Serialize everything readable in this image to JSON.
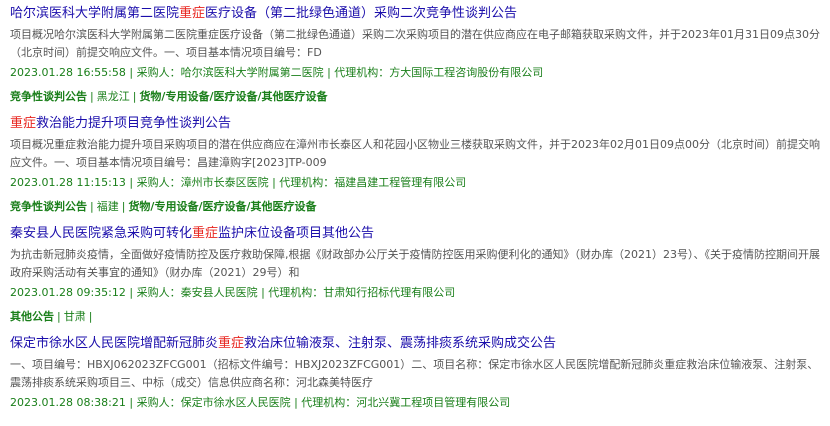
{
  "results": [
    {
      "title_pre": "哈尔滨医科大学附属第二医院",
      "title_kw": "重症",
      "title_post": "医疗设备（第二批绿色通道）采购二次竞争性谈判公告",
      "summary": "项目概况哈尔滨医科大学附属第二医院重症医疗设备（第二批绿色通道）采购二次采购项目的潜在供应商应在电子邮箱获取采购文件，并于2023年01月31日09点30分（北京时间）前提交响应文件。一、项目基本情况项目编号：FD",
      "date": "2023.01.28 16:55:58",
      "buyer_label": "采购人：",
      "buyer": "哈尔滨医科大学附属第二医院",
      "agency_label": "代理机构：",
      "agency": "方大国际工程咨询股份有限公司",
      "tag_type": "竞争性谈判公告",
      "tag_region": "黑龙江",
      "tag_category": "货物/专用设备/医疗设备/其他医疗设备"
    },
    {
      "title_pre": "",
      "title_kw": "重症",
      "title_post": "救治能力提升项目竞争性谈判公告",
      "summary": "项目概况重症救治能力提升项目采购项目的潜在供应商应在漳州市长泰区人和花园小区物业三楼获取采购文件，并于2023年02月01日09点00分（北京时间）前提交响应文件。一、项目基本情况项目编号：昌建漳购字[2023]TP-009",
      "date": "2023.01.28 11:15:13",
      "buyer_label": "采购人：",
      "buyer": "漳州市长泰区医院",
      "agency_label": "代理机构：",
      "agency": "福建昌建工程管理有限公司",
      "tag_type": "竞争性谈判公告",
      "tag_region": "福建",
      "tag_category": "货物/专用设备/医疗设备/其他医疗设备"
    },
    {
      "title_pre": "秦安县人民医院紧急采购可转化",
      "title_kw": "重症",
      "title_post": "监护床位设备项目其他公告",
      "summary": "为抗击新冠肺炎疫情，全面做好疫情防控及医疗救助保障,根据《财政部办公厅关于疫情防控医用采购便利化的通知》（财办库（2021）23号）、《关于疫情防控期间开展政府采购活动有关事宜的通知》（财办库（2021）29号）和",
      "date": "2023.01.28 09:35:12",
      "buyer_label": "采购人：",
      "buyer": "秦安县人民医院",
      "agency_label": "代理机构：",
      "agency": "甘肃知行招标代理有限公司",
      "tag_type": "其他公告",
      "tag_region": "甘肃",
      "tag_category": ""
    },
    {
      "title_pre": "保定市徐水区人民医院增配新冠肺炎",
      "title_kw": "重症",
      "title_post": "救治床位输液泵、注射泵、震荡排痰系统采购成交公告",
      "summary": "一、项目编号：HBXJ062023ZFCG001（招标文件编号：HBXJ2023ZFCG001）二、项目名称：保定市徐水区人民医院增配新冠肺炎重症救治床位输液泵、注射泵、震荡排痰系统采购项目三、中标（成交）信息供应商名称：河北森美特医疗",
      "date": "2023.01.28 08:38:21",
      "buyer_label": "采购人：",
      "buyer": "保定市徐水区人民医院",
      "agency_label": "代理机构：",
      "agency": "河北兴冀工程项目管理有限公司",
      "tag_type": "",
      "tag_region": "",
      "tag_category": ""
    }
  ]
}
